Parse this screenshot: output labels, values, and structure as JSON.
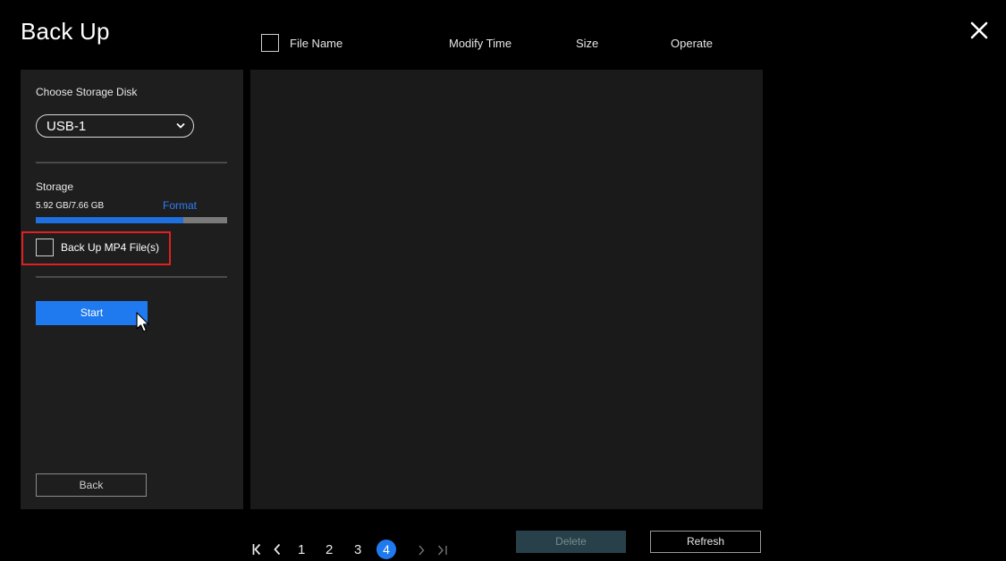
{
  "header": {
    "title": "Back Up"
  },
  "table": {
    "columns": [
      "File Name",
      "Modify Time",
      "Size",
      "Operate"
    ],
    "rows": []
  },
  "left_panel": {
    "choose_label": "Choose Storage Disk",
    "disk_selected": "USB-1",
    "storage_label": "Storage",
    "storage_value": "5.92 GB/7.66 GB",
    "storage_used_fraction": 0.773,
    "format_label": "Format",
    "mp4_label": "Back Up MP4 File(s)",
    "mp4_checked": false,
    "start_label": "Start",
    "back_label": "Back"
  },
  "pager": {
    "pages": [
      "1",
      "2",
      "3",
      "4"
    ],
    "current": "4"
  },
  "actions": {
    "delete_label": "Delete",
    "refresh_label": "Refresh"
  },
  "colors": {
    "accent": "#1f7af0",
    "highlight": "#e02020",
    "panel": "#1e1e1e"
  },
  "icons": [
    "close-icon",
    "chevron-down-icon",
    "mouse-cursor-icon",
    "first-page-icon",
    "prev-page-icon",
    "next-page-icon",
    "last-page-icon"
  ]
}
